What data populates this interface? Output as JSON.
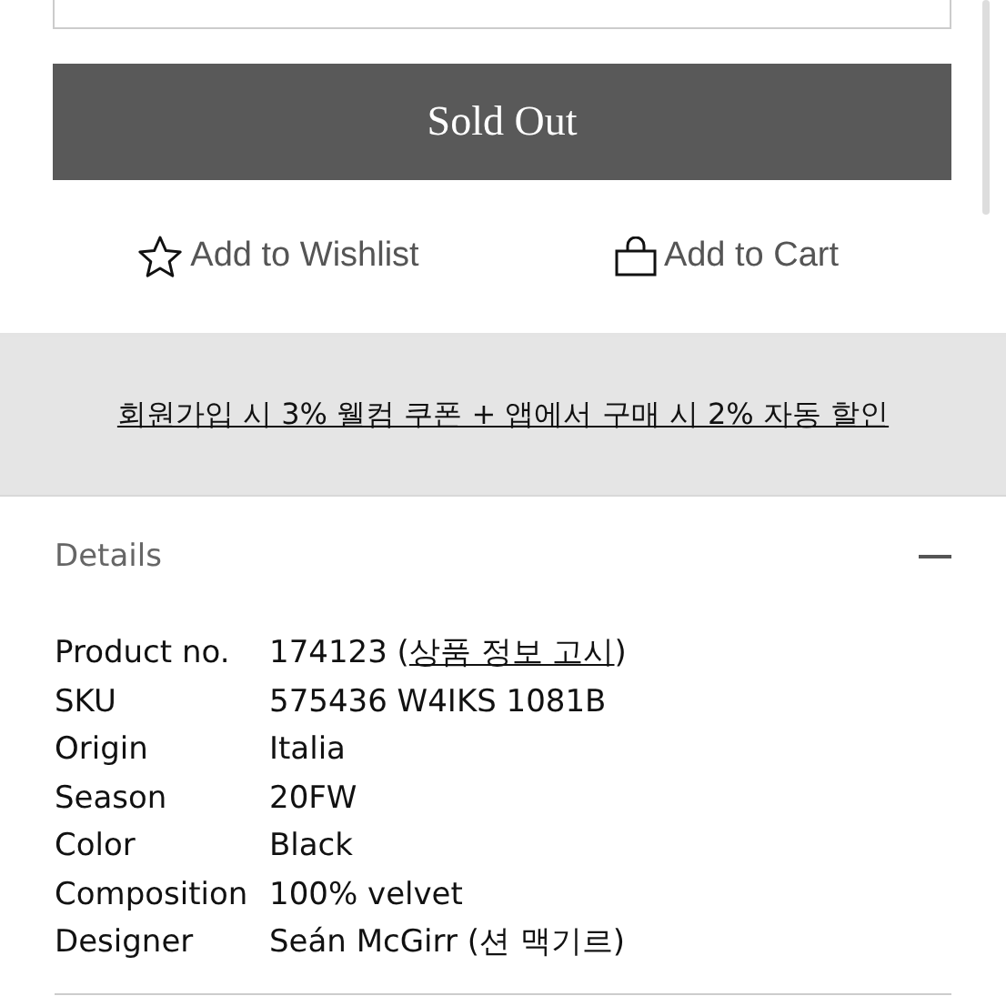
{
  "sold_out_button": {
    "label": "Sold Out"
  },
  "actions": [
    {
      "kind": "wishlist",
      "label": "Add to Wishlist"
    },
    {
      "kind": "cart",
      "label": "Add to Cart"
    }
  ],
  "promo_banner": {
    "text": "회원가입 시 3% 웰컴 쿠폰 + 앱에서 구매 시 2% 자동 할인"
  },
  "details": {
    "title": "Details",
    "expanded": true,
    "rows": [
      {
        "label": "Product no.",
        "value": "174123 (",
        "link": "상품 정보 고시",
        "value_end": ")"
      },
      {
        "label": "SKU",
        "value": "575436 W4IKS 1081B"
      },
      {
        "label": "Origin",
        "value": "Italia"
      },
      {
        "label": "Season",
        "value": "20FW"
      },
      {
        "label": "Color",
        "value": "Black"
      },
      {
        "label": "Composition",
        "value": "100% velvet"
      },
      {
        "label": "Designer",
        "value": "Seán McGirr (션 맥기르)"
      }
    ]
  }
}
